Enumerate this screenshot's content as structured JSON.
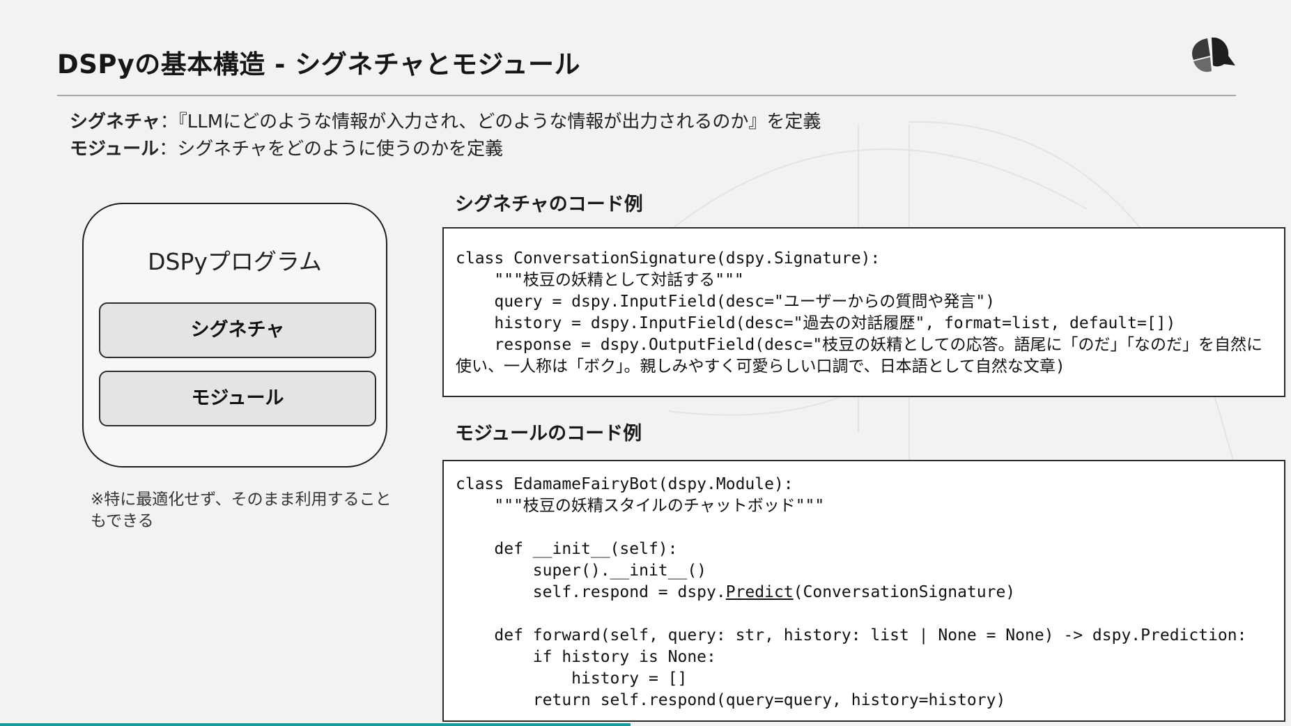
{
  "slide": {
    "title": "DSPyの基本構造 - シグネチャとモジュール",
    "logo_icon": "leaf-logo-icon"
  },
  "definitions": [
    {
      "term": "シグネチャ",
      "sep": "：",
      "text": "『LLMにどのような情報が入力され、どのような情報が出力されるのか』を定義"
    },
    {
      "term": "モジュール",
      "sep": "：",
      "text": "シグネチャをどのように使うのかを定義"
    }
  ],
  "diagram": {
    "title": "DSPyプログラム",
    "items": [
      "シグネチャ",
      "モジュール"
    ],
    "note": "※特に最適化せず、そのまま利用することもできる"
  },
  "signature_example": {
    "label": "シグネチャのコード例",
    "code": "class ConversationSignature(dspy.Signature):\n    \"\"\"枝豆の妖精として対話する\"\"\"\n    query = dspy.InputField(desc=\"ユーザーからの質問や発言\")\n    history = dspy.InputField(desc=\"過去の対話履歴\", format=list, default=[])\n    response = dspy.OutputField(desc=\"枝豆の妖精としての応答。語尾に「のだ」「なのだ」を自然に使い、一人称は「ボク」。親しみやすく可愛らしい口調で、日本語として自然な文章)"
  },
  "module_example": {
    "label": "モジュールのコード例",
    "code_before": "class EdamameFairyBot(dspy.Module):\n    \"\"\"枝豆の妖精スタイルのチャットボッド\"\"\"\n\n    def __init__(self):\n        super().__init__()\n        self.respond = dspy.",
    "code_link": "Predict",
    "code_after": "(ConversationSignature)\n\n    def forward(self, query: str, history: list | None = None) -> dspy.Prediction:\n        if history is None:\n            history = []\n        return self.respond(query=query, history=history)"
  },
  "colors": {
    "background": "#f2f2f2",
    "accent": "#1a9a9a",
    "code_bg": "#ffffff",
    "pill_bg": "#e4e4e4"
  }
}
